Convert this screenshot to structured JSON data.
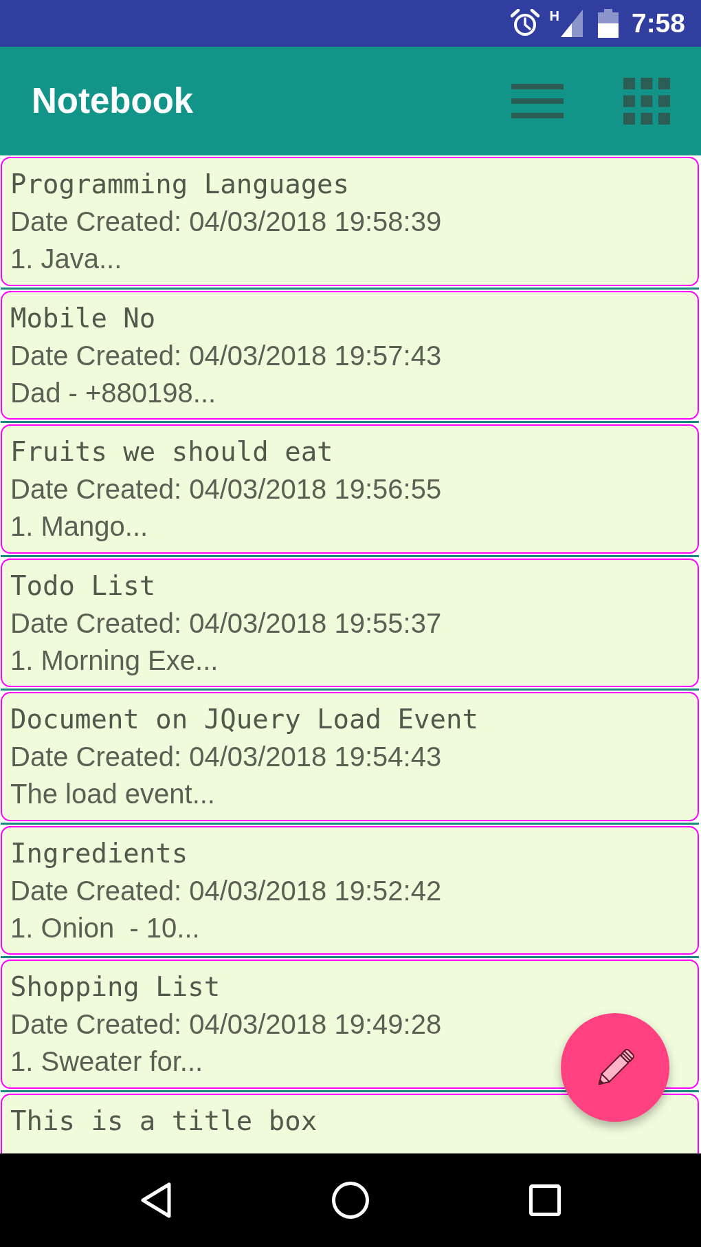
{
  "status_bar": {
    "network_type": "H",
    "time": "7:58"
  },
  "app_bar": {
    "title": "Notebook"
  },
  "notes": [
    {
      "title": "Programming Languages",
      "date": "Date Created: 04/03/2018 19:58:39",
      "preview": "1. Java..."
    },
    {
      "title": "Mobile No",
      "date": "Date Created: 04/03/2018 19:57:43",
      "preview": "Dad - +880198..."
    },
    {
      "title": "Fruits we should eat",
      "date": "Date Created: 04/03/2018 19:56:55",
      "preview": "1. Mango..."
    },
    {
      "title": "Todo List",
      "date": "Date Created: 04/03/2018 19:55:37",
      "preview": "1. Morning Exe..."
    },
    {
      "title": "Document on JQuery Load Event",
      "date": "Date Created: 04/03/2018 19:54:43",
      "preview": "The load event..."
    },
    {
      "title": "Ingredients",
      "date": "Date Created: 04/03/2018 19:52:42",
      "preview": "1. Onion  - 10..."
    },
    {
      "title": "Shopping List",
      "date": "Date Created: 04/03/2018 19:49:28",
      "preview": "1. Sweater for..."
    },
    {
      "title": "This is a title box"
    }
  ]
}
